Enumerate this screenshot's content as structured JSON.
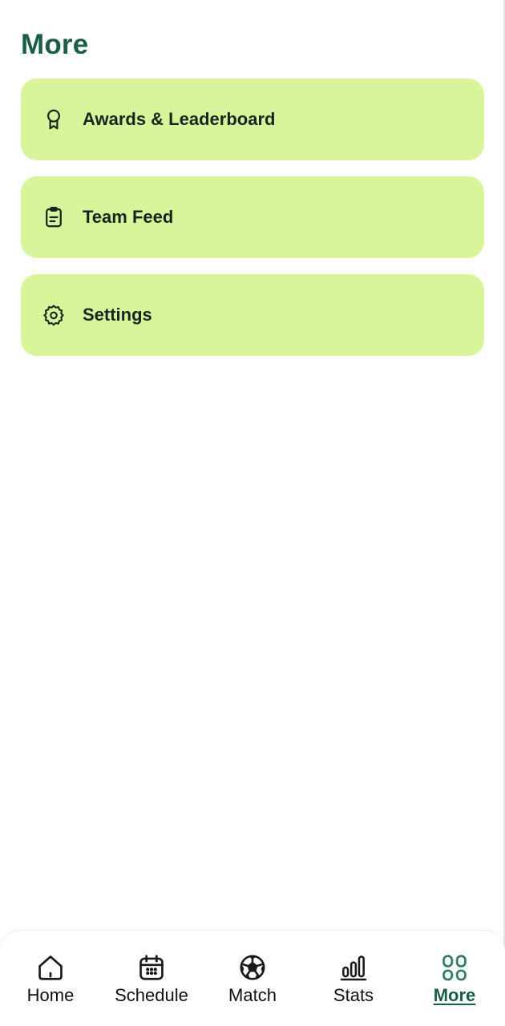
{
  "header": {
    "title": "More"
  },
  "menu": {
    "items": [
      {
        "label": "Awards & Leaderboard",
        "icon": "award-ribbon-icon"
      },
      {
        "label": "Team Feed",
        "icon": "clipboard-icon"
      },
      {
        "label": "Settings",
        "icon": "gear-icon"
      }
    ]
  },
  "bottom_nav": {
    "items": [
      {
        "label": "Home",
        "icon": "home-icon",
        "active": false
      },
      {
        "label": "Schedule",
        "icon": "calendar-icon",
        "active": false
      },
      {
        "label": "Match",
        "icon": "soccer-ball-icon",
        "active": false
      },
      {
        "label": "Stats",
        "icon": "bar-chart-icon",
        "active": false
      },
      {
        "label": "More",
        "icon": "grid-apps-icon",
        "active": true
      }
    ]
  },
  "colors": {
    "accent": "#1c5e43",
    "card_background": "#d8f59c",
    "text": "#16261d",
    "nav_text": "#111111",
    "background": "#ffffff"
  }
}
